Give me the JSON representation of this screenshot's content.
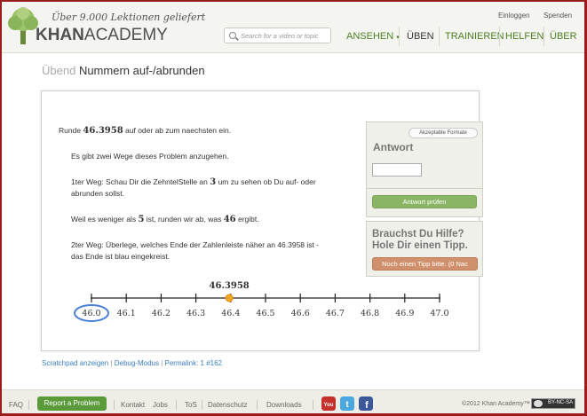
{
  "header": {
    "tagline": "Über 9.000 Lektionen geliefert",
    "brand_khan": "KHAN",
    "brand_academy": "ACADEMY",
    "search_placeholder": "Search for a video or topic",
    "login": "Einloggen",
    "donate": "Spenden",
    "nav": [
      {
        "label": "ANSEHEN",
        "caret": "▾"
      },
      {
        "label": "ÜBEN"
      },
      {
        "label": "TRAINIEREN"
      },
      {
        "label": "HELFEN"
      },
      {
        "label": "ÜBER"
      }
    ]
  },
  "title": {
    "prefix": "Übend",
    "text": "Nummern auf-/abrunden"
  },
  "problem": {
    "intro_pre": "Runde ",
    "intro_num": "46.3958",
    "intro_post": " auf oder ab zum naechsten ein.",
    "hint1": "Es gibt zwei Wege dieses Problem anzugehen.",
    "hint2_a": "1ter Weg: Schau Dir die ZehntelStelle an ",
    "hint2_num": "3",
    "hint2_b": " um zu sehen ob Du auf- oder",
    "hint2_c": "abrunden sollst.",
    "hint3_a": "Weil es weniger als ",
    "hint3_num1": "5",
    "hint3_b": " ist, runden wir ab, was ",
    "hint3_num2": "46",
    "hint3_c": " ergibt.",
    "hint4_a": "2ter Weg: Überlege, welches Ende der Zahlenleiste näher an 46.3958 ist -",
    "hint4_b": "das Ende ist blau eingekreist."
  },
  "numberline": {
    "point_label": "46.3958",
    "ticks": [
      "46.0",
      "46.1",
      "46.2",
      "46.3",
      "46.4",
      "46.5",
      "46.6",
      "46.7",
      "46.8",
      "46.9",
      "47.0"
    ],
    "circled": "46.0",
    "point_value": 46.3958,
    "colors": {
      "point": "#f5a623",
      "circle": "#4a7fd6"
    }
  },
  "answer": {
    "formats_btn": "Akzeptable Formate",
    "label": "Antwort",
    "input_value": "",
    "check_btn": "Antwort prüfen"
  },
  "hint": {
    "title_line1": "Brauchst Du Hilfe?",
    "title_line2": "Hole Dir einen Tipp.",
    "button": "Noch einen Tipp bitte. (0 Nac"
  },
  "below_links": {
    "scratchpad": "Scratchpad anzeigen",
    "debug": "Debug-Modus",
    "permalink": "Permalink: 1 #162"
  },
  "footer": {
    "faq": "FAQ",
    "report": "Report a Problem",
    "contact": "Kontakt",
    "jobs": "Jobs",
    "tos": "ToS",
    "privacy": "Datenschutz",
    "downloads": "Downloads",
    "copyright": "©2012 Khan Academy™",
    "license": "BY-NC-SA"
  }
}
